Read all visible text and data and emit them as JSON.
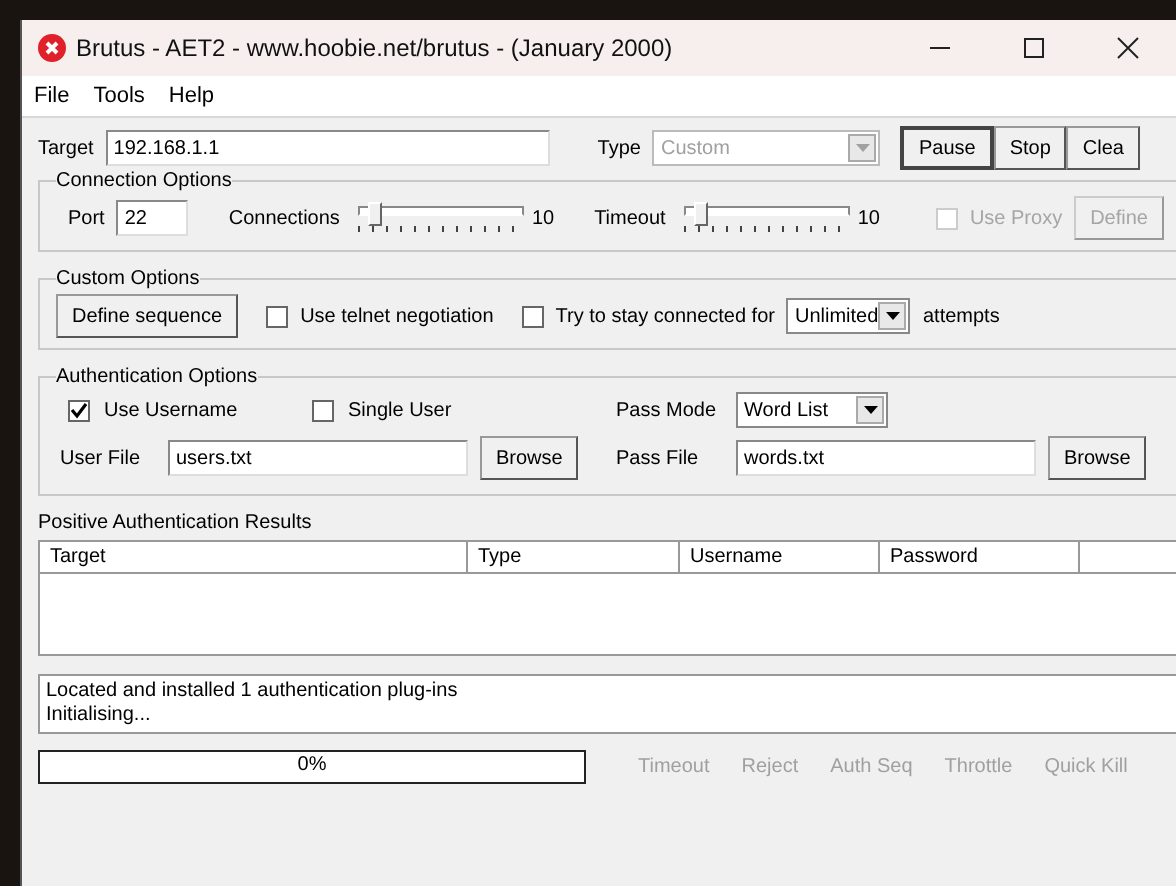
{
  "window": {
    "title": "Brutus - AET2 - www.hoobie.net/brutus - (January 2000)"
  },
  "menu": [
    "File",
    "Tools",
    "Help"
  ],
  "target": {
    "label": "Target",
    "value": "192.168.1.1"
  },
  "type": {
    "label": "Type",
    "value": "Custom",
    "disabled": true
  },
  "actions": [
    "Pause",
    "Stop",
    "Clea"
  ],
  "connection_options": {
    "title": "Connection Options",
    "port_label": "Port",
    "port": "22",
    "connections": {
      "label": "Connections",
      "level": 0.05,
      "reading": "10"
    },
    "timeout": {
      "label": "Timeout",
      "level": 0.05,
      "reading": "10"
    },
    "use_proxy": {
      "label": "Use Proxy",
      "checked": false,
      "disabled": true
    },
    "define": {
      "label": "Define",
      "disabled": true
    }
  },
  "custom_options": {
    "title": "Custom Options",
    "define_sequence": "Define sequence",
    "telnet": {
      "label": "Use telnet negotiation",
      "checked": false
    },
    "stay_connected": {
      "label": "Try to stay connected for",
      "checked": false
    },
    "attempts": "Unlimited",
    "attempts_suffix": "attempts"
  },
  "authentication_options": {
    "title": "Authentication Options",
    "use_username": {
      "label": "Use Username",
      "checked": true
    },
    "single_user": {
      "label": "Single User",
      "checked": false
    },
    "pass_mode_label": "Pass Mode",
    "pass_mode": "Word List",
    "user_file_label": "User File",
    "user_file": "users.txt",
    "browse_user": "Browse",
    "pass_file_label": "Pass File",
    "pass_file": "words.txt",
    "browse_pass": "Browse"
  },
  "results": {
    "title": "Positive Authentication Results",
    "columns": [
      "Target",
      "Type",
      "Username",
      "Password"
    ]
  },
  "log": [
    "Located and installed 1 authentication plug-ins",
    "Initialising..."
  ],
  "progress": {
    "reading": "0%"
  },
  "indicators": [
    {
      "label": "Timeout",
      "disabled": true
    },
    {
      "label": "Reject",
      "disabled": true
    },
    {
      "label": "Auth Seq",
      "disabled": true
    },
    {
      "label": "Throttle",
      "disabled": true
    },
    {
      "label": "Quick Kill",
      "disabled": true
    }
  ]
}
